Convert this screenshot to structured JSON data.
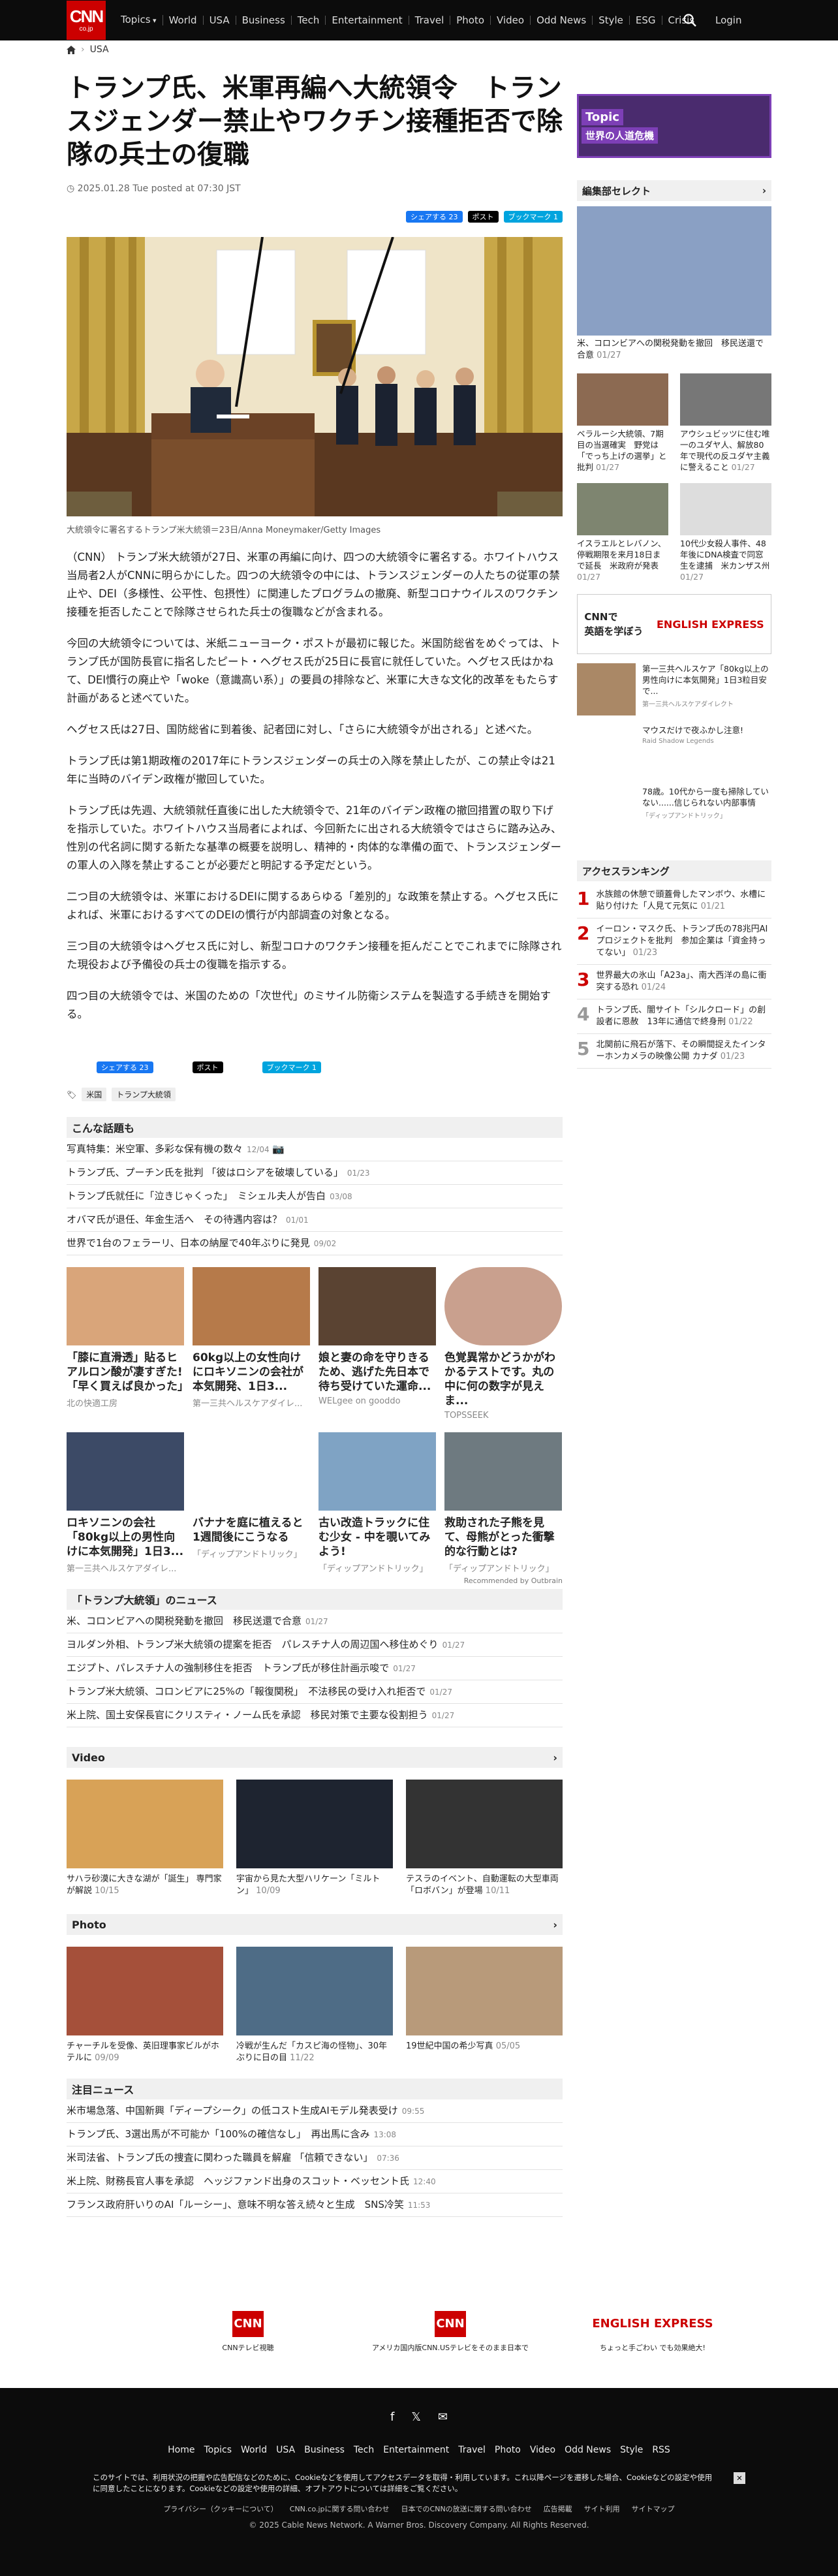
{
  "header": {
    "logo": "CNN",
    "logo_sub": "co.jp",
    "nav": [
      "Topics",
      "World",
      "USA",
      "Business",
      "Tech",
      "Entertainment",
      "Travel",
      "Photo",
      "Video",
      "Odd News",
      "Style",
      "ESG",
      "Crisis"
    ],
    "login": "Login"
  },
  "breadcrumb": "USA",
  "article": {
    "title": "トランプ氏、米軍再編へ大統領令　トランスジェンダー禁止やワクチン接種拒否で除隊の兵士の復職",
    "date": "2025.01.28 Tue posted at 07:30 JST",
    "share": {
      "fb": "シェアする 23",
      "x": "ポスト",
      "hatena": "ブックマーク 1"
    },
    "caption": "大統領令に署名するトランプ米大統領＝23日/Anna Moneymaker/Getty Images",
    "paragraphs": [
      "（CNN） トランプ米大統領が27日、米軍の再編に向け、四つの大統領令に署名する。ホワイトハウス当局者2人がCNNに明らかにした。四つの大統領令の中には、トランスジェンダーの人たちの従軍の禁止や、DEI（多様性、公平性、包摂性）に関連したプログラムの撤廃、新型コロナウイルスのワクチン接種を拒否したことで除隊させられた兵士の復職などが含まれる。",
      "今回の大統領令については、米紙ニューヨーク・ポストが最初に報じた。米国防総省をめぐっては、トランプ氏が国防長官に指名したピート・ヘグセス氏が25日に長官に就任していた。ヘグセス氏はかねて、DEI慣行の廃止や「woke（意識高い系）」の要員の排除など、米軍に大きな文化的改革をもたらす計画があると述べていた。",
      "ヘグセス氏は27日、国防総省に到着後、記者団に対し、「さらに大統領令が出される」と述べた。",
      "トランプ氏は第1期政権の2017年にトランスジェンダーの兵士の入隊を禁止したが、この禁止令は21年に当時のバイデン政権が撤回していた。",
      "トランプ氏は先週、大統領就任直後に出した大統領令で、21年のバイデン政権の撤回措置の取り下げを指示していた。ホワイトハウス当局者によれば、今回新たに出される大統領令ではさらに踏み込み、性別の代名詞に関する新たな基準の概要を説明し、精神的・肉体的な準備の面で、トランスジェンダーの軍人の入隊を禁止することが必要だと明記する予定だという。",
      "二つ目の大統領令は、米軍におけるDEIに関するあらゆる「差別的」な政策を禁止する。ヘグセス氏によれば、米軍におけるすべてのDEIの慣行が内部調査の対象となる。",
      "三つ目の大統領令はヘグセス氏に対し、新型コロナのワクチン接種を拒んだことでこれまでに除隊された現役および予備役の兵士の復職を指示する。",
      "四つ目の大統領令では、米国のための「次世代」のミサイル防衛システムを製造する手続きを開始する。"
    ],
    "tags": [
      "米国",
      "トランプ大統領"
    ]
  },
  "related": {
    "heading": "こんな話題も",
    "items": [
      {
        "t": "写真特集：米空軍、多彩な保有機の数々",
        "d": "12/04"
      },
      {
        "t": "トランプ氏、プーチン氏を批判 「彼はロシアを破壊している」",
        "d": "01/23"
      },
      {
        "t": "トランプ氏就任に「泣きじゃくった」　ミシェル夫人が告白",
        "d": "03/08"
      },
      {
        "t": "オバマ氏が退任、年金生活へ　その待遇内容は？",
        "d": "01/01"
      },
      {
        "t": "世界で1台のフェラーリ、日本の納屋で40年ぶりに発見",
        "d": "09/02"
      }
    ]
  },
  "outbrain": [
    {
      "t": "「膝に直滑透」貼るヒアルロン酸が凄すぎた!「早く買えば良かった」",
      "s": "北の快適工房"
    },
    {
      "t": "60kg以上の女性向けにロキソニンの会社が本気開発、1日3...",
      "s": "第一三共ヘルスケアダイレ..."
    },
    {
      "t": "娘と妻の命を守りきるため、逃げた先日本で待ち受けていた運命...",
      "s": "WELgee on gooddo"
    },
    {
      "t": "色覚異常かどうかがわかるテストです。丸の中に何の数字が見えま...",
      "s": "TOPSSEEK"
    },
    {
      "t": "ロキソニンの会社「80kg以上の男性向けに本気開発」1日3...",
      "s": "第一三共ヘルスケアダイレ..."
    },
    {
      "t": "バナナを庭に植えると1週間後にこうなる",
      "s": "「ディップアンドトリック」"
    },
    {
      "t": "古い改造トラックに住む少女 - 中を覗いてみよう!",
      "s": "「ディップアンドトリック」"
    },
    {
      "t": "救助された子熊を見て、母熊がとった衝撃的な行動とは?",
      "s": "「ディップアンドトリック」"
    }
  ],
  "outbrain_credit": "Recommended by Outbrain",
  "trump_news": {
    "heading": "「トランプ大統領」のニュース",
    "items": [
      {
        "t": "米、コロンビアへの関税発動を撤回　移民送還で合意",
        "d": "01/27"
      },
      {
        "t": "ヨルダン外相、トランプ米大統領の提案を拒否　パレスチナ人の周辺国へ移住めぐり",
        "d": "01/27"
      },
      {
        "t": "エジプト、パレスチナ人の強制移住を拒否　トランプ氏が移住計画示唆で",
        "d": "01/27"
      },
      {
        "t": "トランプ米大統領、コロンビアに25%の「報復関税」　不法移民の受け入れ拒否で",
        "d": "01/27"
      },
      {
        "t": "米上院、国土安保長官にクリスティ・ノーム氏を承認　移民対策で主要な役割担う",
        "d": "01/27"
      }
    ]
  },
  "video": {
    "heading": "Video",
    "items": [
      {
        "t": "サハラ砂漠に大きな湖が「誕生」 専門家が解説",
        "d": "10/15"
      },
      {
        "t": "宇宙から見た大型ハリケーン「ミルトン」",
        "d": "10/09"
      },
      {
        "t": "テスラのイベント、自動運転の大型車両「ロボバン」が登場",
        "d": "10/11"
      }
    ]
  },
  "photo_sec": {
    "heading": "Photo",
    "items": [
      {
        "t": "チャーチルを受像、英旧理事家ビルがホテルに",
        "d": "09/09"
      },
      {
        "t": "冷戦が生んだ「カスピ海の怪物」、30年ぶりに日の目",
        "d": "11/22"
      },
      {
        "t": "19世紀中国の希少写真",
        "d": "05/05"
      }
    ]
  },
  "hot_news": {
    "heading": "注目ニュース",
    "items": [
      {
        "t": "米市場急落、中国新興「ディープシーク」の低コスト生成AIモデル発表受け",
        "d": "09:55"
      },
      {
        "t": "トランプ氏、3選出馬が不可能か「100%の確信なし」　再出馬に含み",
        "d": "13:08"
      },
      {
        "t": "米司法省、トランプ氏の捜査に関わった職員を解雇 「信頼できない」",
        "d": "07:36"
      },
      {
        "t": "米上院、財務長官人事を承認　ヘッジファンド出身のスコット・ベッセント氏",
        "d": "12:40"
      },
      {
        "t": "フランス政府肝いりのAI「ルーシー」、意味不明な答え続々と生成　SNS冷笑",
        "d": "11:53"
      }
    ]
  },
  "bottom_logos": [
    {
      "label": "CNNテレビ視聴"
    },
    {
      "label": "アメリカ国内版CNN.USテレビをそのまま日本で"
    },
    {
      "label": "ちょっと手ごわい でも効果絶大!"
    }
  ],
  "sidebar": {
    "banner": {
      "top": "Topic",
      "main": "世界の人道危機"
    },
    "editor_pick": "編集部セレクト",
    "feature": {
      "t": "米、コロンビアへの関税発動を撤回　移民送還で合意",
      "d": "01/27"
    },
    "grid": [
      {
        "t": "ベラルーシ大統領、7期目の当選確実　野党は「でっち上げの選挙」と批判",
        "d": "01/27"
      },
      {
        "t": "アウシュビッツに住む唯一のユダヤ人、解放80年で現代の反ユダヤ主義に警えること",
        "d": "01/27"
      },
      {
        "t": "イスラエルとレバノン、停戦期限を来月18日まで延長　米政府が発表",
        "d": "01/27"
      },
      {
        "t": "10代少女殺人事件、48年後にDNA検査で同窓生を逮捕　米カンザス州",
        "d": "01/27"
      }
    ],
    "english_ad": {
      "t1": "CNNで",
      "t2": "英語を学ぼう",
      "brand": "ENGLISH EXPRESS"
    },
    "ads": [
      {
        "t": "第一三共ヘルスケア「80kg以上の男性向けに本気開発」1日3粒目安で...",
        "s": "第一三共ヘルスケアダイレクト"
      },
      {
        "t": "マウスだけで夜ふかし注意!",
        "s": "Raid Shadow Legends"
      },
      {
        "t": "78歳。10代から一度も掃除していない......信じられない内部事情",
        "s": "「ディップアンドトリック」"
      }
    ],
    "ranking_head": "アクセスランキング",
    "ranking": [
      {
        "n": "1",
        "t": "水族館の休憩で頭蓋骨したマンボウ、水槽に貼り付けた「人見て元気に",
        "d": "01/21"
      },
      {
        "n": "2",
        "t": "イーロン・マスク氏、トランプ氏の78兆円AIプロジェクトを批判　参加企業は「資金持ってない」",
        "d": "01/23"
      },
      {
        "n": "3",
        "t": "世界最大の氷山「A23a」、南大西洋の島に衝突する恐れ",
        "d": "01/24"
      },
      {
        "n": "4",
        "t": "トランプ氏、闇サイト「シルクロード」の創設者に恩赦　13年に通信で終身刑",
        "d": "01/22"
      },
      {
        "n": "5",
        "t": "北関前に飛石が落下、その瞬間捉えたインターホンカメラの映像公開 カナダ",
        "d": "01/23"
      }
    ]
  },
  "footer": {
    "nav": [
      "Home",
      "Topics",
      "World",
      "USA",
      "Business",
      "Tech",
      "Entertainment",
      "Travel",
      "Photo",
      "Video",
      "Odd News",
      "Style",
      "RSS"
    ],
    "cookie": "このサイトでは、利用状況の把握や広告配信などのために、Cookieなどを使用してアクセスデータを取得・利用しています。これ以降ページを遷移した場合、Cookieなどの設定や使用に同意したことになります。Cookieなどの設定や使用の詳細、オプトアウトについては詳細をご覧ください。",
    "links": [
      "プライバシー（クッキーについて）",
      "CNN.co.jpに関する問い合わせ",
      "日本でのCNNの放送に関する問い合わせ",
      "広告掲載",
      "サイト利用",
      "サイトマップ"
    ],
    "copyright": "© 2025 Cable News Network. A Warner Bros. Discovery Company. All Rights Reserved."
  },
  "colors": {
    "brand": "#cc0000",
    "dark": "#0c0c0c"
  }
}
